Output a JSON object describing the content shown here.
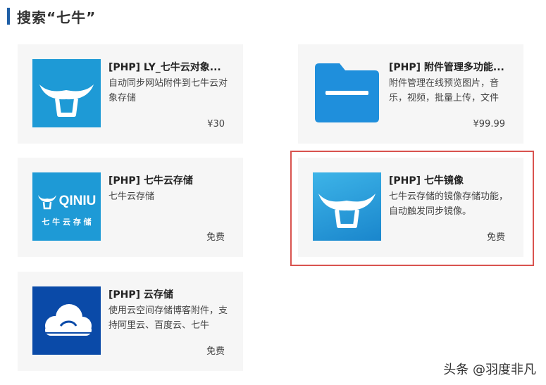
{
  "heading": {
    "title": "搜索“七牛”"
  },
  "colors": {
    "accent": "#1f5fa6",
    "selection": "#d9534f",
    "tile_blue": "#1e9ad6"
  },
  "cards": [
    {
      "name": "[PHP] LY_七牛云对象...",
      "desc": "自动同步网站附件到七牛云对象存储",
      "price": "¥30",
      "icon": "qiniu-bull-icon"
    },
    {
      "name": "[PHP] 附件管理多功能...",
      "desc": "附件管理在线预览图片，音乐，视频，批量上传，文件",
      "price": "¥99.99",
      "icon": "folder-icon"
    },
    {
      "name": "[PHP] 七牛云存储",
      "desc": "七牛云存储",
      "price": "免费",
      "icon": "qiniu-logo-icon",
      "logo_text": "QINIU",
      "logo_sub": "七 牛 云 存 储"
    },
    {
      "name": "[PHP] 七牛镜像",
      "desc": "七牛云存储的镜像存储功能，自动触发同步镜像。",
      "price": "免费",
      "icon": "qiniu-bull-icon"
    },
    {
      "name": "[PHP] 云存储",
      "desc": "使用云空间存储博客附件，支持阿里云、百度云、七牛",
      "price": "免费",
      "icon": "cloud-icon"
    }
  ],
  "watermark": "头条 @羽度非凡"
}
